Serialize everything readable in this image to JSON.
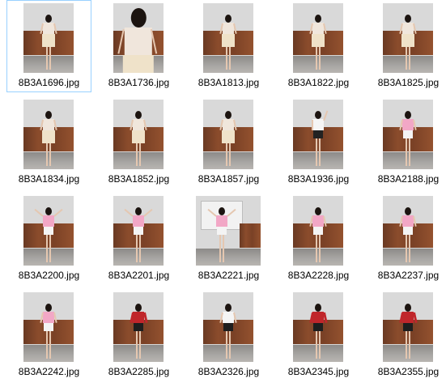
{
  "files": [
    {
      "name": "8B3A1696.jpg",
      "selected": true,
      "top": "#f0e6dc",
      "bottom": "#efe2c9",
      "style": "dress"
    },
    {
      "name": "8B3A1736.jpg",
      "selected": false,
      "top": "#f0e6dc",
      "bottom": "#efe2c9",
      "style": "closeup"
    },
    {
      "name": "8B3A1813.jpg",
      "selected": false,
      "top": "#f0e6dc",
      "bottom": "#efe2c9",
      "style": "dress"
    },
    {
      "name": "8B3A1822.jpg",
      "selected": false,
      "top": "#f0e6dc",
      "bottom": "#efe2c9",
      "style": "dress"
    },
    {
      "name": "8B3A1825.jpg",
      "selected": false,
      "top": "#f0e6dc",
      "bottom": "#efe2c9",
      "style": "dress"
    },
    {
      "name": "8B3A1834.jpg",
      "selected": false,
      "top": "#f0e6dc",
      "bottom": "#efe2c9",
      "style": "dress"
    },
    {
      "name": "8B3A1852.jpg",
      "selected": false,
      "top": "#f0e6dc",
      "bottom": "#efe2c9",
      "style": "dress"
    },
    {
      "name": "8B3A1857.jpg",
      "selected": false,
      "top": "#f0e6dc",
      "bottom": "#efe2c9",
      "style": "dress"
    },
    {
      "name": "8B3A1936.jpg",
      "selected": false,
      "top": "#f5f5f5",
      "bottom": "#222222",
      "style": "armup"
    },
    {
      "name": "8B3A2188.jpg",
      "selected": false,
      "top": "#f2a7c6",
      "bottom": "#f4f4f4",
      "style": "pink"
    },
    {
      "name": "8B3A2200.jpg",
      "selected": false,
      "top": "#f2a7c6",
      "bottom": "#f4f4f4",
      "style": "pinkarms"
    },
    {
      "name": "8B3A2201.jpg",
      "selected": false,
      "top": "#f2a7c6",
      "bottom": "#f4f4f4",
      "style": "pinkarms"
    },
    {
      "name": "8B3A2221.jpg",
      "selected": false,
      "top": "#f2a7c6",
      "bottom": "#f4f4f4",
      "style": "dance"
    },
    {
      "name": "8B3A2228.jpg",
      "selected": false,
      "top": "#f2a7c6",
      "bottom": "#f4f4f4",
      "style": "pink"
    },
    {
      "name": "8B3A2237.jpg",
      "selected": false,
      "top": "#f2a7c6",
      "bottom": "#f4f4f4",
      "style": "pink"
    },
    {
      "name": "8B3A2242.jpg",
      "selected": false,
      "top": "#f2a7c6",
      "bottom": "#f4f4f4",
      "style": "pink"
    },
    {
      "name": "8B3A2285.jpg",
      "selected": false,
      "top": "#c0262b",
      "bottom": "#1e1e1e",
      "style": "jacket"
    },
    {
      "name": "8B3A2326.jpg",
      "selected": false,
      "top": "#f5f5f5",
      "bottom": "#1e1e1e",
      "style": "tee"
    },
    {
      "name": "8B3A2345.jpg",
      "selected": false,
      "top": "#c0262b",
      "bottom": "#1e1e1e",
      "style": "jacket"
    },
    {
      "name": "8B3A2355.jpg",
      "selected": false,
      "top": "#c0262b",
      "bottom": "#1e1e1e",
      "style": "jacket"
    }
  ]
}
